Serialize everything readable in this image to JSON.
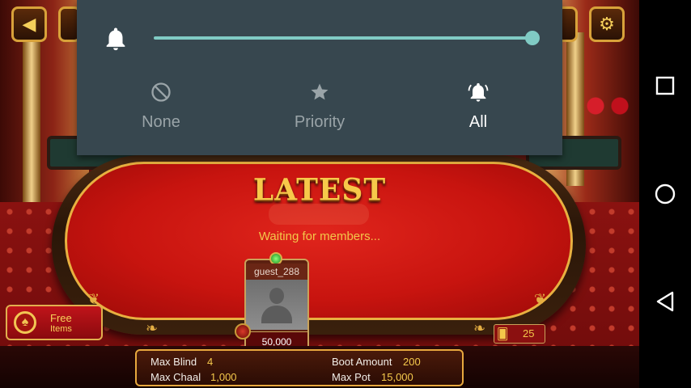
{
  "notification_panel": {
    "volume_level": 1.0,
    "modes": [
      {
        "label": "None",
        "icon": "do-not-disturb-icon"
      },
      {
        "label": "Priority",
        "icon": "star-icon"
      },
      {
        "label": "All",
        "icon": "bell-ringing-icon",
        "selected": true
      }
    ],
    "accent_color": "#80cbc4"
  },
  "game": {
    "table_title": "LATEST",
    "status_text": "Waiting for members...",
    "player": {
      "name": "guest_288",
      "chips": "50,000"
    },
    "free_items": {
      "line1": "Free",
      "line2": "Items"
    },
    "card_count": "25",
    "info": {
      "max_blind_label": "Max Blind",
      "max_blind_value": "4",
      "max_chaal_label": "Max Chaal",
      "max_chaal_value": "1,000",
      "boot_amount_label": "Boot Amount",
      "boot_amount_value": "200",
      "max_pot_label": "Max Pot",
      "max_pot_value": "15,000"
    }
  },
  "system_nav": {
    "buttons": [
      "recents",
      "home",
      "back"
    ]
  }
}
